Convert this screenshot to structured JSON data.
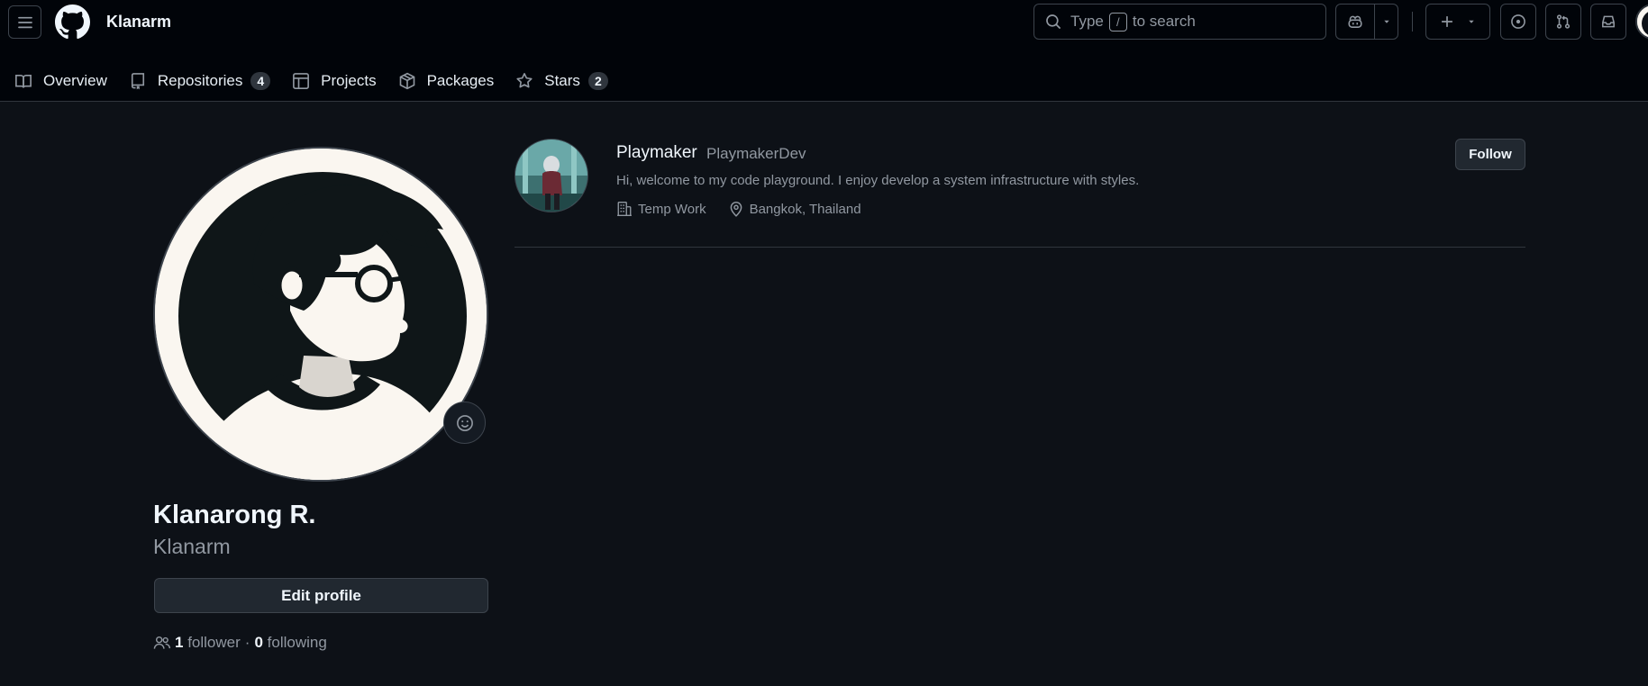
{
  "header": {
    "brand": "Klanarm",
    "search": {
      "prefix": "Type",
      "key": "/",
      "suffix": "to search"
    }
  },
  "tabs": [
    {
      "label": "Overview",
      "icon": "book-icon"
    },
    {
      "label": "Repositories",
      "icon": "repo-icon",
      "count": "4"
    },
    {
      "label": "Projects",
      "icon": "table-icon"
    },
    {
      "label": "Packages",
      "icon": "package-icon"
    },
    {
      "label": "Stars",
      "icon": "star-icon",
      "count": "2"
    }
  ],
  "profile": {
    "full_name": "Klanarong R.",
    "username": "Klanarm",
    "edit_label": "Edit profile",
    "followers_count": "1",
    "followers_label": "follower",
    "separator": "·",
    "following_count": "0",
    "following_label": "following"
  },
  "card": {
    "name": "Playmaker",
    "login": "PlaymakerDev",
    "bio": "Hi, welcome to my code playground. I enjoy develop a system infrastructure with styles.",
    "company": "Temp Work",
    "location": "Bangkok, Thailand",
    "follow_label": "Follow"
  },
  "colors": {
    "page_bg": "#0d1117",
    "header_bg": "#010409",
    "border": "#30363d",
    "text_primary": "#f0f6fc",
    "text_muted": "#9198a1"
  }
}
